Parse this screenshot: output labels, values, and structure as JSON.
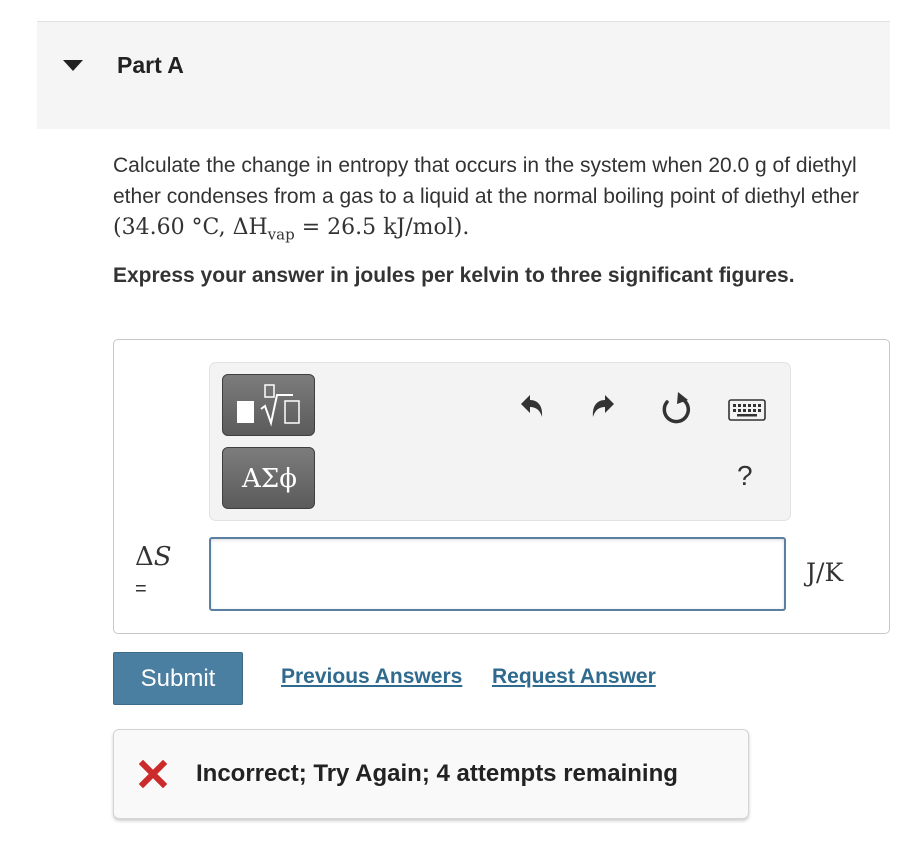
{
  "part": {
    "title": "Part A",
    "caret_icon": "caret-down-icon"
  },
  "question": {
    "text": "Calculate the change in entropy that occurs in the system when 20.0 g of diethyl ether condenses from a gas to a liquid at the normal boiling point of diethyl ether ",
    "math_open": "(34.60 °C,  ΔH",
    "math_sub": "vap",
    "math_close": " = 26.5 kJ/mol)."
  },
  "instructions": "Express your answer in joules per kelvin to three significant figures.",
  "toolbar": {
    "template_button_icon": "templates-sqrt-icon",
    "greek_button_label": "ΑΣϕ",
    "undo_icon": "undo-icon",
    "redo_icon": "redo-icon",
    "reset_icon": "reset-icon",
    "keyboard_icon": "keyboard-icon",
    "help_label": "?"
  },
  "answer": {
    "variable_delta": "Δ",
    "variable_symbol": "S",
    "equals": "=",
    "value": "",
    "unit": "J/K"
  },
  "actions": {
    "submit_label": "Submit",
    "previous_answers_label": "Previous Answers",
    "request_answer_label": "Request Answer"
  },
  "feedback": {
    "icon": "x-mark-icon",
    "message": "Incorrect; Try Again; 4 attempts remaining",
    "color": "#cc2b2b"
  },
  "colors": {
    "submit_bg": "#4b7fa1",
    "link": "#2f6a8f",
    "header_bg": "#f5f5f5"
  }
}
